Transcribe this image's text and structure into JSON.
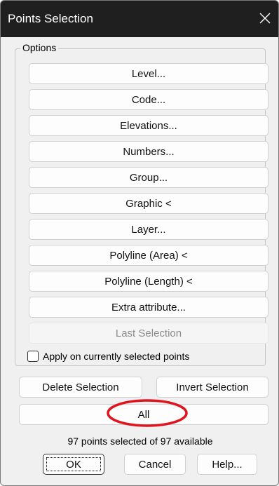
{
  "window": {
    "title": "Points Selection"
  },
  "options_group": {
    "label": "Options",
    "buttons": [
      "Level...",
      "Code...",
      "Elevations...",
      "Numbers...",
      "Group...",
      "Graphic <",
      "Layer...",
      "Polyline (Area) <",
      "Polyline (Length) <",
      "Extra attribute..."
    ],
    "last_selection": "Last Selection",
    "apply_checkbox": {
      "label": "Apply on currently selected points",
      "checked": false
    }
  },
  "actions": {
    "delete_selection": "Delete Selection",
    "invert_selection": "Invert Selection",
    "all": "All"
  },
  "status": "97 points selected of 97 available",
  "footer": {
    "ok": "OK",
    "cancel": "Cancel",
    "help": "Help..."
  },
  "colors": {
    "titlebar": "#1f1f1f",
    "annotation": "#e0141e"
  }
}
